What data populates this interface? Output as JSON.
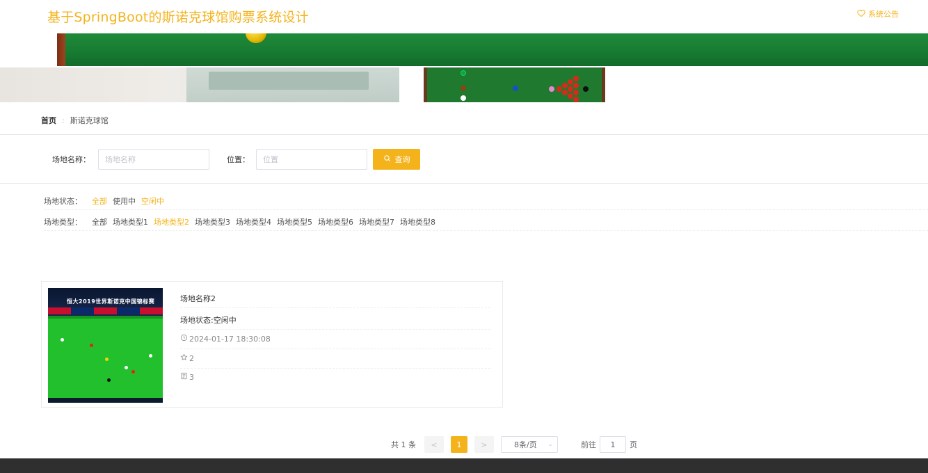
{
  "header": {
    "title": "基于SpringBoot的斯诺克球馆购票系统设计",
    "notice_label": "系统公告"
  },
  "breadcrumb": {
    "home": "首页",
    "separator": ":",
    "current": "斯诺克球馆"
  },
  "search": {
    "name_label": "场地名称：",
    "name_placeholder": "场地名称",
    "name_value": "",
    "location_label": "位置：",
    "location_placeholder": "位置",
    "location_value": "",
    "button_label": "查询"
  },
  "filters": {
    "status": {
      "label": "场地状态：",
      "options": [
        "全部",
        "使用中",
        "空闲中"
      ],
      "active_color_items": [
        "全部",
        "空闲中"
      ]
    },
    "type": {
      "label": "场地类型：",
      "options": [
        "全部",
        "场地类型1",
        "场地类型2",
        "场地类型3",
        "场地类型4",
        "场地类型5",
        "场地类型6",
        "场地类型7",
        "场地类型8"
      ],
      "selected": "场地类型2"
    }
  },
  "card": {
    "thumbnail_caption": "恒大2019世界斯诺克中国锦标赛",
    "name": "场地名称2",
    "status": "场地状态:空闲中",
    "time": "2024-01-17 18:30:08",
    "stars": "2",
    "comments": "3"
  },
  "pagination": {
    "total": "共 1 条",
    "prev": "<",
    "current_page": "1",
    "next": ">",
    "page_size": "8条/页",
    "goto_label": "前往",
    "goto_value": "1",
    "goto_suffix": "页"
  },
  "colors": {
    "accent": "#f4b31b",
    "footer": "#2f2f2f"
  }
}
